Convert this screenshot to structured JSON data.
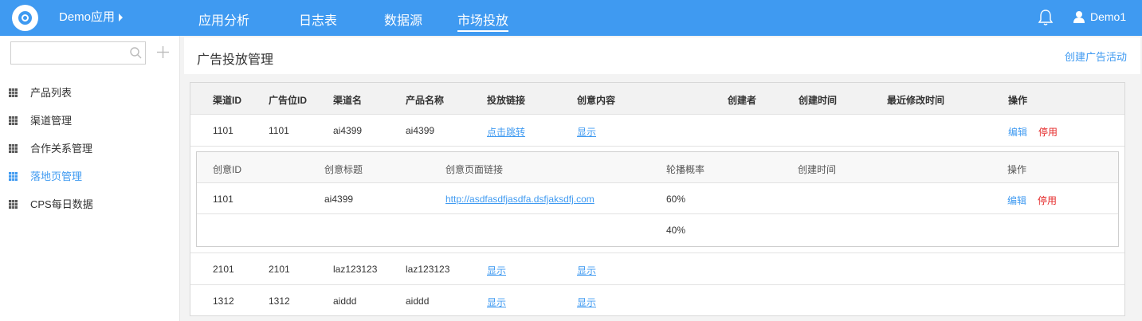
{
  "app": {
    "name": "Demo应用",
    "user": "Demo1"
  },
  "nav": [
    {
      "label": "应用分析"
    },
    {
      "label": "日志表"
    },
    {
      "label": "数据源"
    },
    {
      "label": "市场投放"
    }
  ],
  "sidebar": {
    "search": {
      "value": "",
      "placeholder": ""
    },
    "items": [
      {
        "label": "产品列表"
      },
      {
        "label": "渠道管理"
      },
      {
        "label": "合作关系管理"
      },
      {
        "label": "落地页管理"
      },
      {
        "label": "CPS每日数据"
      }
    ]
  },
  "page": {
    "title": "广告投放管理",
    "create_label": "创建广告活动"
  },
  "table": {
    "headers": [
      "渠道ID",
      "广告位ID",
      "渠道名",
      "产品名称",
      "投放链接",
      "创意内容",
      "创建者",
      "创建时间",
      "最近修改时间",
      "操作"
    ],
    "rows": [
      {
        "channel_id": "1101",
        "slot_id": "1101",
        "channel_name": "ai4399",
        "product": "ai4399",
        "link": "点击跳转",
        "creative": "显示",
        "edit": "编辑",
        "stop": "停用"
      },
      {
        "channel_id": "2101",
        "slot_id": "2101",
        "channel_name": "laz123123",
        "product": "laz123123",
        "link": "显示",
        "creative": "显示"
      },
      {
        "channel_id": "1312",
        "slot_id": "1312",
        "channel_name": "aiddd",
        "product": "aiddd",
        "link": "显示",
        "creative": "显示"
      }
    ]
  },
  "sub_table": {
    "headers": [
      "创意ID",
      "创意标题",
      "创意页面链接",
      "轮播概率",
      "创建时间",
      "操作"
    ],
    "rows": [
      {
        "id": "1101",
        "title": "ai4399",
        "url": "http://asdfasdfjasdfa.dsfjaksdfj.com",
        "prob": "60%",
        "edit": "编辑",
        "stop": "停用"
      },
      {
        "prob": "40%"
      }
    ]
  },
  "colors": {
    "accent": "#3f9af1",
    "danger": "#e52828"
  }
}
